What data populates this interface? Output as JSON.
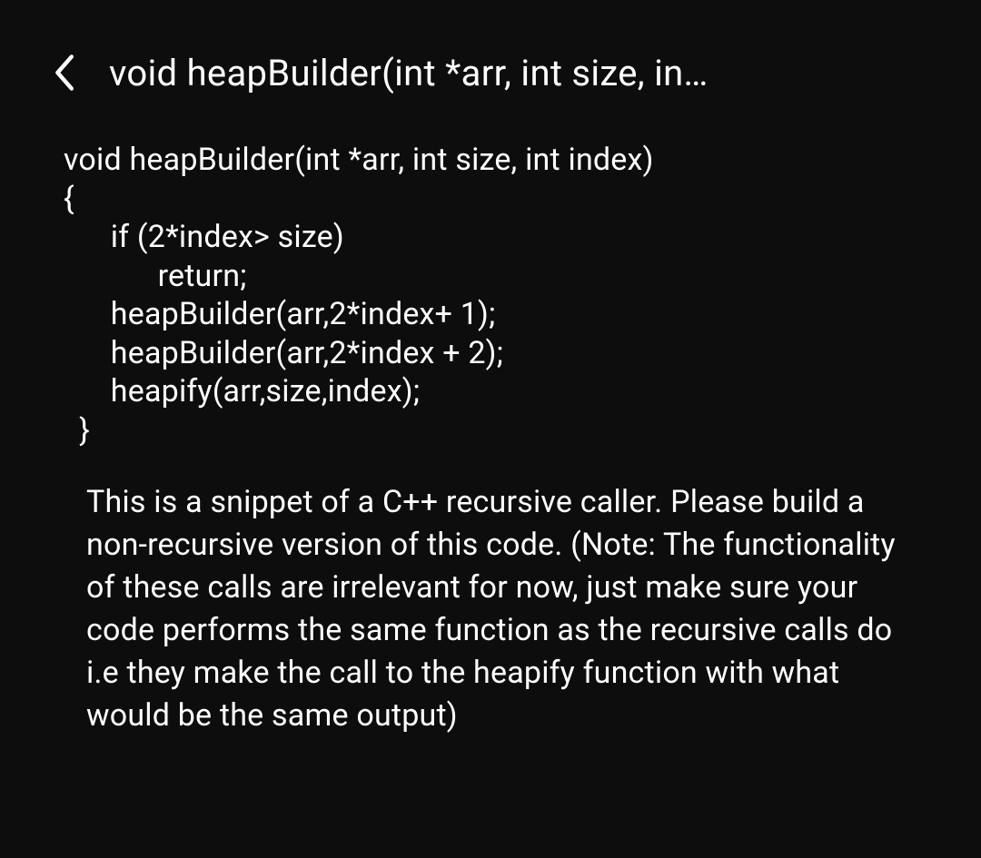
{
  "header": {
    "title": "void heapBuilder(int *arr, int size, in…"
  },
  "code": {
    "line1": "void heapBuilder(int *arr, int size, int index)",
    "line2": "{",
    "line3": "      if (2*index> size)",
    "line4": "            return;",
    "line5": "      heapBuilder(arr,2*index+ 1);",
    "line6": "      heapBuilder(arr,2*index + 2);",
    "line7": "      heapify(arr,size,index);",
    "line8": "  }"
  },
  "description": {
    "text": "This is a snippet of a C++ recursive caller. Please build a non-recursive version of this code. (Note: The functionality of these calls are irrelevant for now, just make sure your code performs the same function as the recursive calls do i.e they make the call to the heapify function with what would be the same output)"
  }
}
